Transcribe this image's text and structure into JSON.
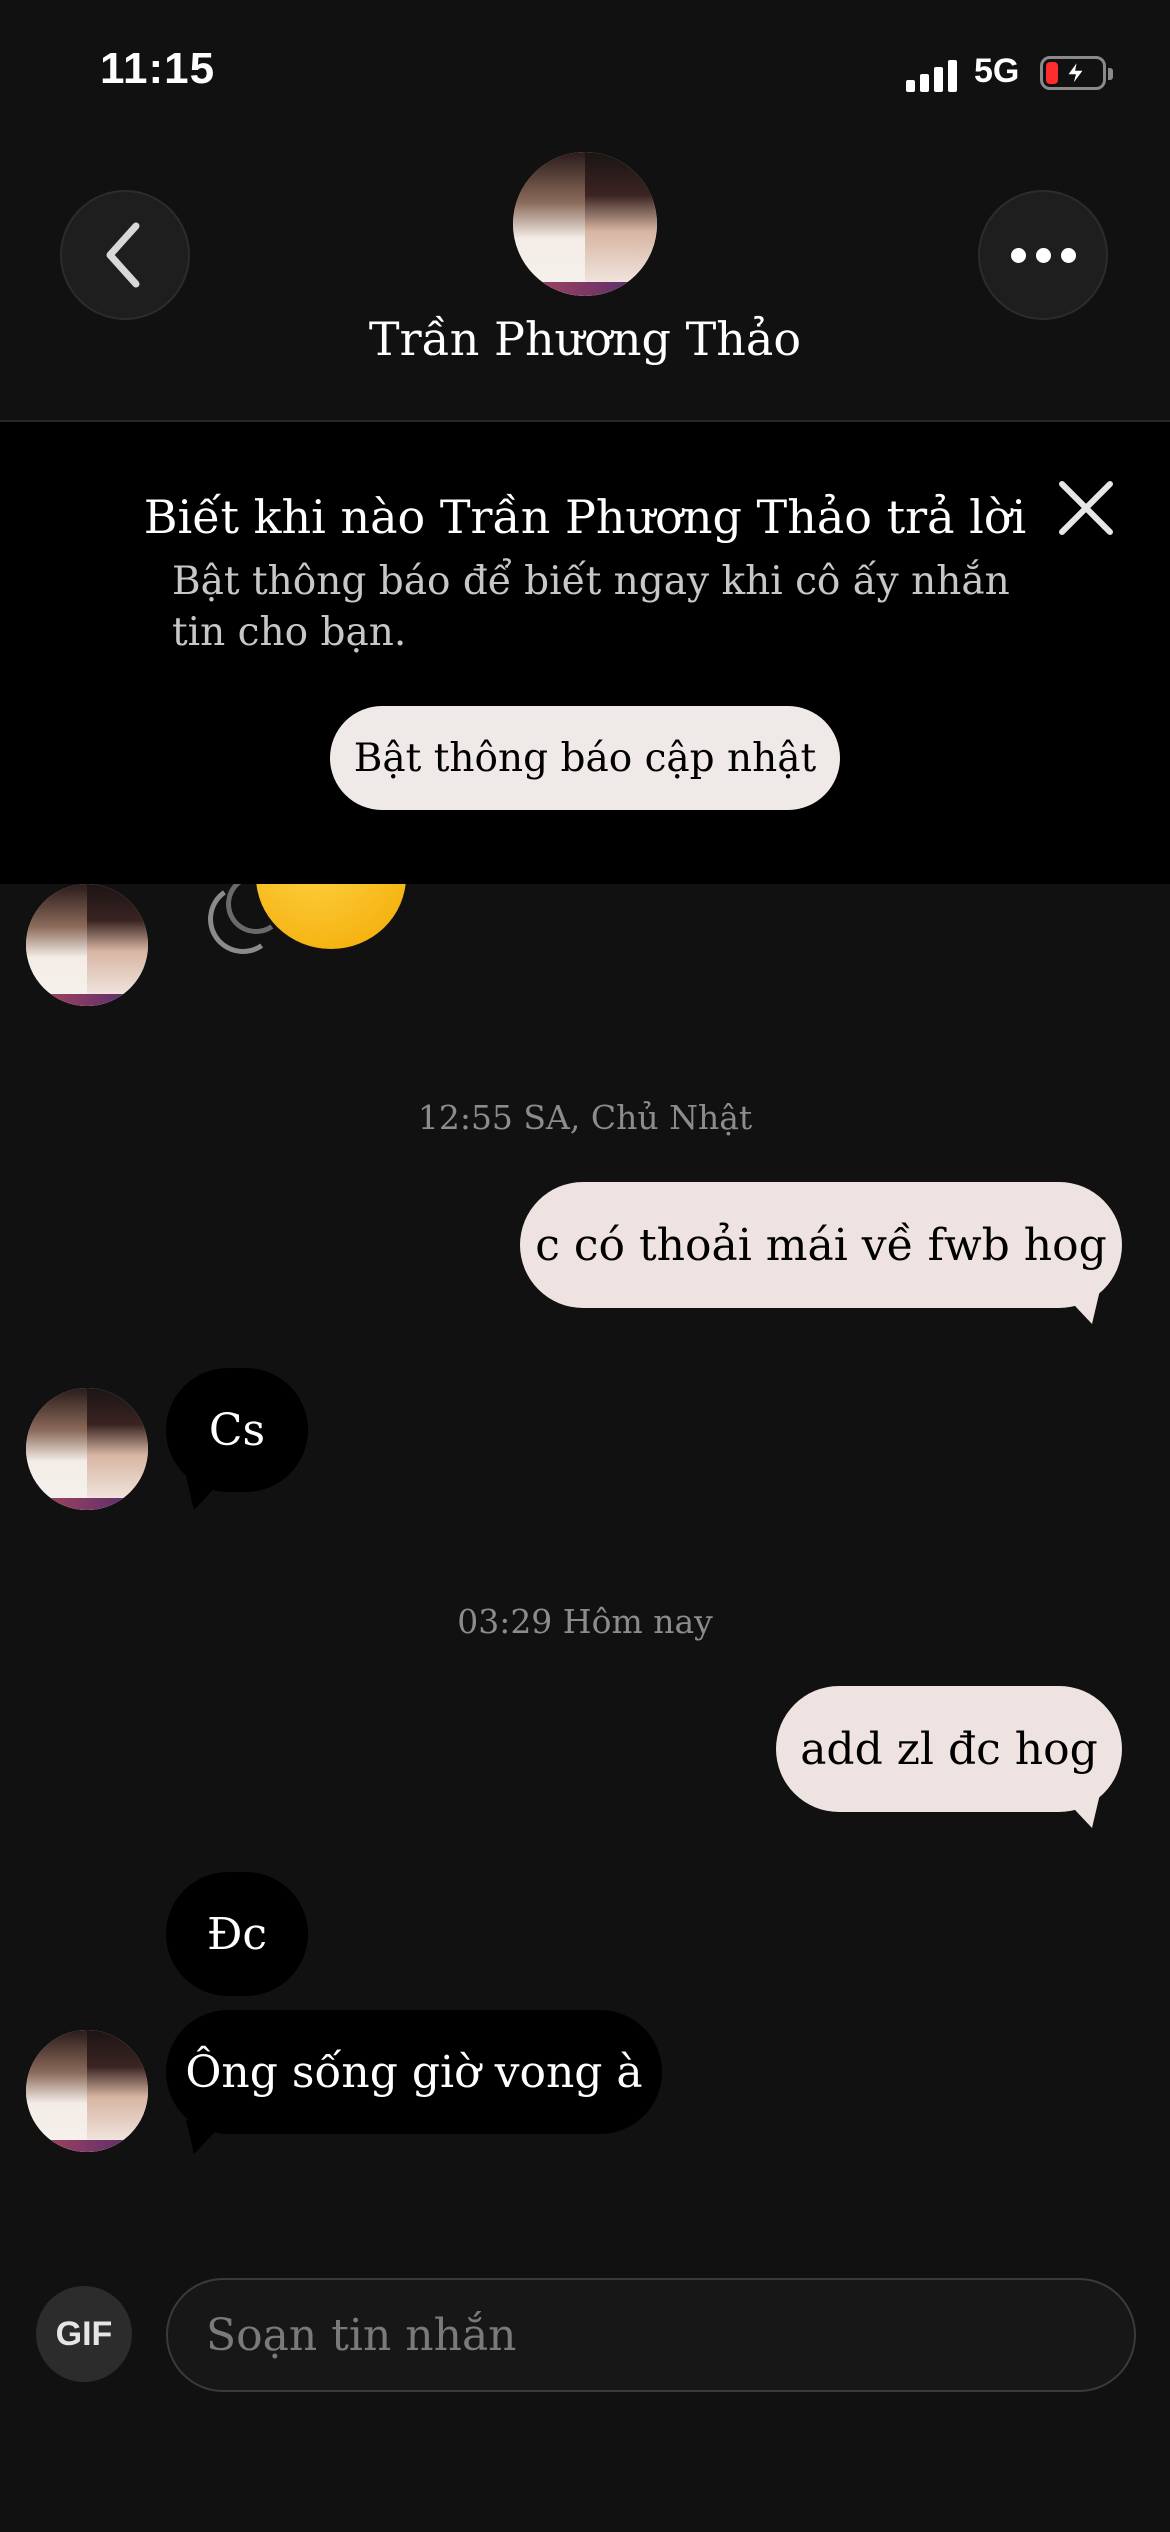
{
  "status_bar": {
    "time": "11:15",
    "network": "5G",
    "battery_icon": "battery-low-charging-icon",
    "colors": {
      "battery_low": "#ff2d2d"
    }
  },
  "header": {
    "name": "Trần Phương Thảo",
    "back_icon": "chevron-left-icon",
    "more_icon": "more-horizontal-icon"
  },
  "notification_banner": {
    "title": "Biết khi nào Trần Phương Thảo trả lời",
    "body": "Bật thông báo để biết ngay khi cô ấy nhắn tin cho bạn.",
    "button_label": "Bật thông báo cập nhật",
    "close_icon": "close-icon"
  },
  "messages": [
    {
      "type": "sticker",
      "sender": "contact",
      "icon": "waving-hand-emoji"
    },
    {
      "type": "timestamp",
      "text": "12:55 SA, Chủ Nhật"
    },
    {
      "type": "text",
      "sender": "me",
      "text": "c có thoải mái về fwb hog"
    },
    {
      "type": "text",
      "sender": "contact",
      "text": "Cs"
    },
    {
      "type": "timestamp",
      "text": "03:29 Hôm nay"
    },
    {
      "type": "text",
      "sender": "me",
      "text": "add zl đc hog"
    },
    {
      "type": "text",
      "sender": "contact",
      "text": "Đc"
    },
    {
      "type": "text",
      "sender": "contact",
      "text": "Ông sống giờ vong à"
    }
  ],
  "composer": {
    "gif_label": "GIF",
    "placeholder": "Soạn tin nhắn"
  },
  "colors": {
    "background": "#121111",
    "outgoing_bubble": "#efe3e1",
    "incoming_bubble": "#000000",
    "banner_background": "#000000"
  }
}
